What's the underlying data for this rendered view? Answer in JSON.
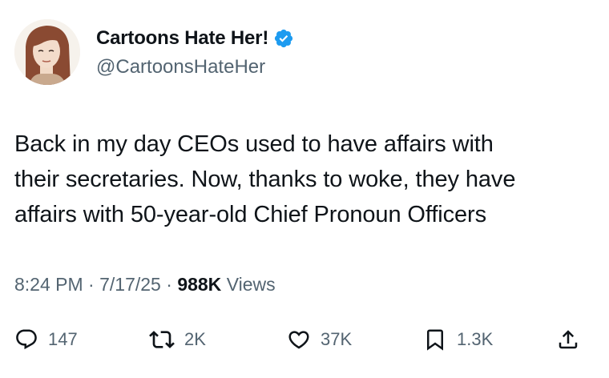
{
  "author": {
    "display_name": "Cartoons Hate Her!",
    "handle": "@CartoonsHateHer",
    "verified": true
  },
  "tweet": {
    "lines": [
      "Back in my day CEOs used to have affairs with",
      "their secretaries. Now, thanks to woke, they have",
      "affairs with 50-year-old Chief Pronoun Officers"
    ]
  },
  "meta": {
    "time": "8:24 PM",
    "separator": "·",
    "date": "7/17/25",
    "views_count": "988K",
    "views_label": "Views"
  },
  "actions": {
    "replies": "147",
    "reposts": "2K",
    "likes": "37K",
    "bookmarks": "1.3K"
  },
  "colors": {
    "text_primary": "#0f1419",
    "text_secondary": "#536471",
    "verified_blue": "#1d9bf0"
  },
  "icons": {
    "reply": "speech-bubble-icon",
    "repost": "repost-arrows-icon",
    "like": "heart-icon",
    "bookmark": "bookmark-icon",
    "share": "share-upload-icon",
    "verified": "verified-badge-icon"
  }
}
